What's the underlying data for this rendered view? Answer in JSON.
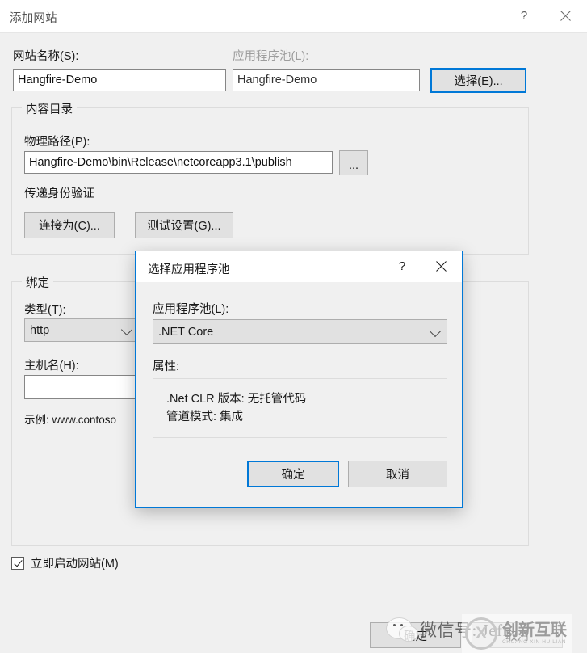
{
  "window": {
    "title": "添加网站",
    "help_label": "?",
    "close_icon": "close-icon"
  },
  "form": {
    "site_name_label": "网站名称(S):",
    "site_name_value": "Hangfire-Demo",
    "app_pool_label": "应用程序池(L):",
    "app_pool_value": "Hangfire-Demo",
    "select_button": "选择(E)..."
  },
  "content_directory": {
    "group_title": "内容目录",
    "physical_path_label": "物理路径(P):",
    "physical_path_value": "Hangfire-Demo\\bin\\Release\\netcoreapp3.1\\publish",
    "browse_button": "...",
    "passthrough_auth_label": "传递身份验证",
    "connect_as_button": "连接为(C)...",
    "test_settings_button": "测试设置(G)..."
  },
  "binding": {
    "group_title": "绑定",
    "type_label": "类型(T):",
    "type_value": "http",
    "host_label": "主机名(H):",
    "host_value": "",
    "example_text": "示例: www.contoso"
  },
  "start_site": {
    "label": "立即启动网站(M)",
    "checked": true
  },
  "footer": {
    "ok_button": "确定",
    "cancel_button": "取消"
  },
  "modal": {
    "title": "选择应用程序池",
    "help_label": "?",
    "app_pool_label": "应用程序池(L):",
    "app_pool_value": ".NET Core",
    "properties_label": "属性:",
    "properties_line1": ".Net CLR 版本: 无托管代码",
    "properties_line2": "管道模式: 集成",
    "ok_button": "确定",
    "cancel_button": "取消"
  },
  "watermarks": {
    "wechat_text": "微信号: Jeff",
    "brand_main": "创新互联",
    "brand_sub": "CHUANG XIN HU LIAN",
    "brand_mark": "X"
  },
  "colors": {
    "accent": "#0078d7",
    "window_bg": "#f0f0f0",
    "titlebar_bg": "#ffffff",
    "button_bg": "#e1e1e1",
    "disabled_text": "#9d9d9d"
  }
}
